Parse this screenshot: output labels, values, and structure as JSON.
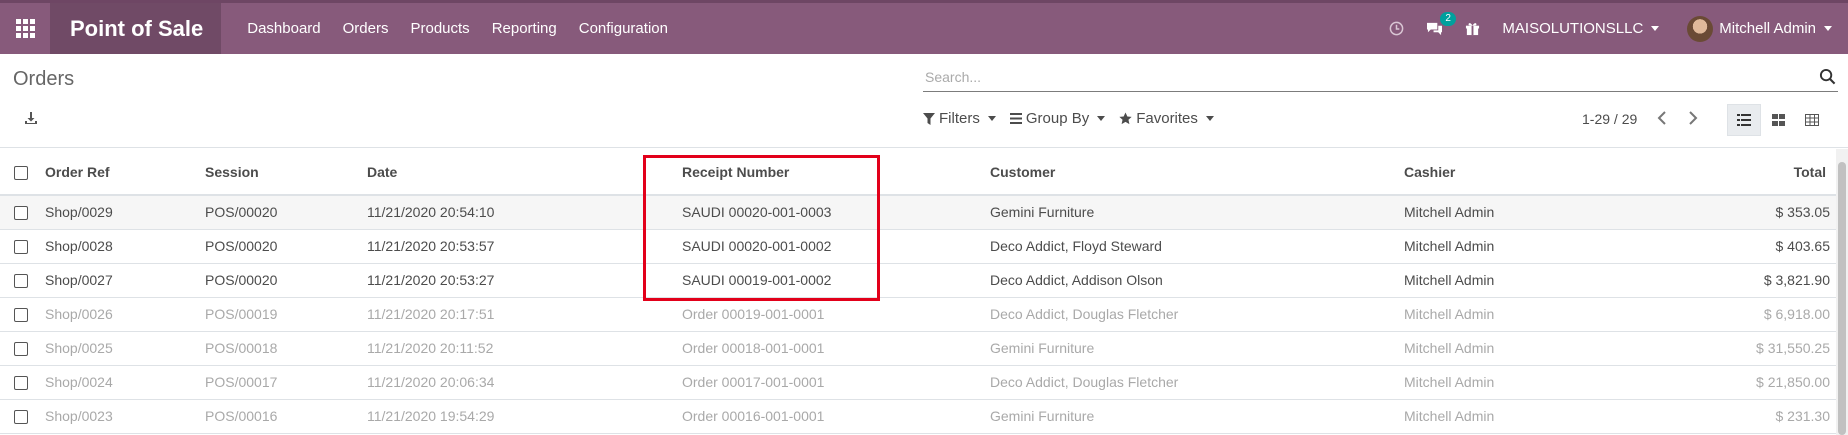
{
  "navbar": {
    "app_title": "Point of Sale",
    "menu": [
      "Dashboard",
      "Orders",
      "Products",
      "Reporting",
      "Configuration"
    ],
    "messages_count": "2",
    "company": "MAISOLUTIONSLLC",
    "user": "Mitchell Admin",
    "bar_color": "#875A7B"
  },
  "control": {
    "breadcrumb": "Orders",
    "search_placeholder": "Search...",
    "filters_label": "Filters",
    "groupby_label": "Group By",
    "favorites_label": "Favorites",
    "pager_value": "1-29 / 29"
  },
  "table": {
    "columns": [
      "Order Ref",
      "Session",
      "Date",
      "Receipt Number",
      "Customer",
      "Cashier",
      "Total"
    ],
    "rows": [
      {
        "ref": "Shop/0029",
        "session": "POS/00020",
        "date": "11/21/2020 20:54:10",
        "receipt": "SAUDI 00020-001-0003",
        "customer": "Gemini Furniture",
        "cashier": "Mitchell Admin",
        "total": "$ 353.05",
        "state": "paid"
      },
      {
        "ref": "Shop/0028",
        "session": "POS/00020",
        "date": "11/21/2020 20:53:57",
        "receipt": "SAUDI 00020-001-0002",
        "customer": "Deco Addict, Floyd Steward",
        "cashier": "Mitchell Admin",
        "total": "$ 403.65",
        "state": "paid"
      },
      {
        "ref": "Shop/0027",
        "session": "POS/00020",
        "date": "11/21/2020 20:53:27",
        "receipt": "SAUDI 00019-001-0002",
        "customer": "Deco Addict, Addison Olson",
        "cashier": "Mitchell Admin",
        "total": "$ 3,821.90",
        "state": "paid"
      },
      {
        "ref": "Shop/0026",
        "session": "POS/00019",
        "date": "11/21/2020 20:17:51",
        "receipt": "Order 00019-001-0001",
        "customer": "Deco Addict, Douglas Fletcher",
        "cashier": "Mitchell Admin",
        "total": "$ 6,918.00",
        "state": "done"
      },
      {
        "ref": "Shop/0025",
        "session": "POS/00018",
        "date": "11/21/2020 20:11:52",
        "receipt": "Order 00018-001-0001",
        "customer": "Gemini Furniture",
        "cashier": "Mitchell Admin",
        "total": "$ 31,550.25",
        "state": "done"
      },
      {
        "ref": "Shop/0024",
        "session": "POS/00017",
        "date": "11/21/2020 20:06:34",
        "receipt": "Order 00017-001-0001",
        "customer": "Deco Addict, Douglas Fletcher",
        "cashier": "Mitchell Admin",
        "total": "$ 21,850.00",
        "state": "done"
      },
      {
        "ref": "Shop/0023",
        "session": "POS/00016",
        "date": "11/21/2020 19:54:29",
        "receipt": "Order 00016-001-0001",
        "customer": "Gemini Furniture",
        "cashier": "Mitchell Admin",
        "total": "$ 231.30",
        "state": "done"
      }
    ]
  },
  "highlight_color": "#e2001a"
}
